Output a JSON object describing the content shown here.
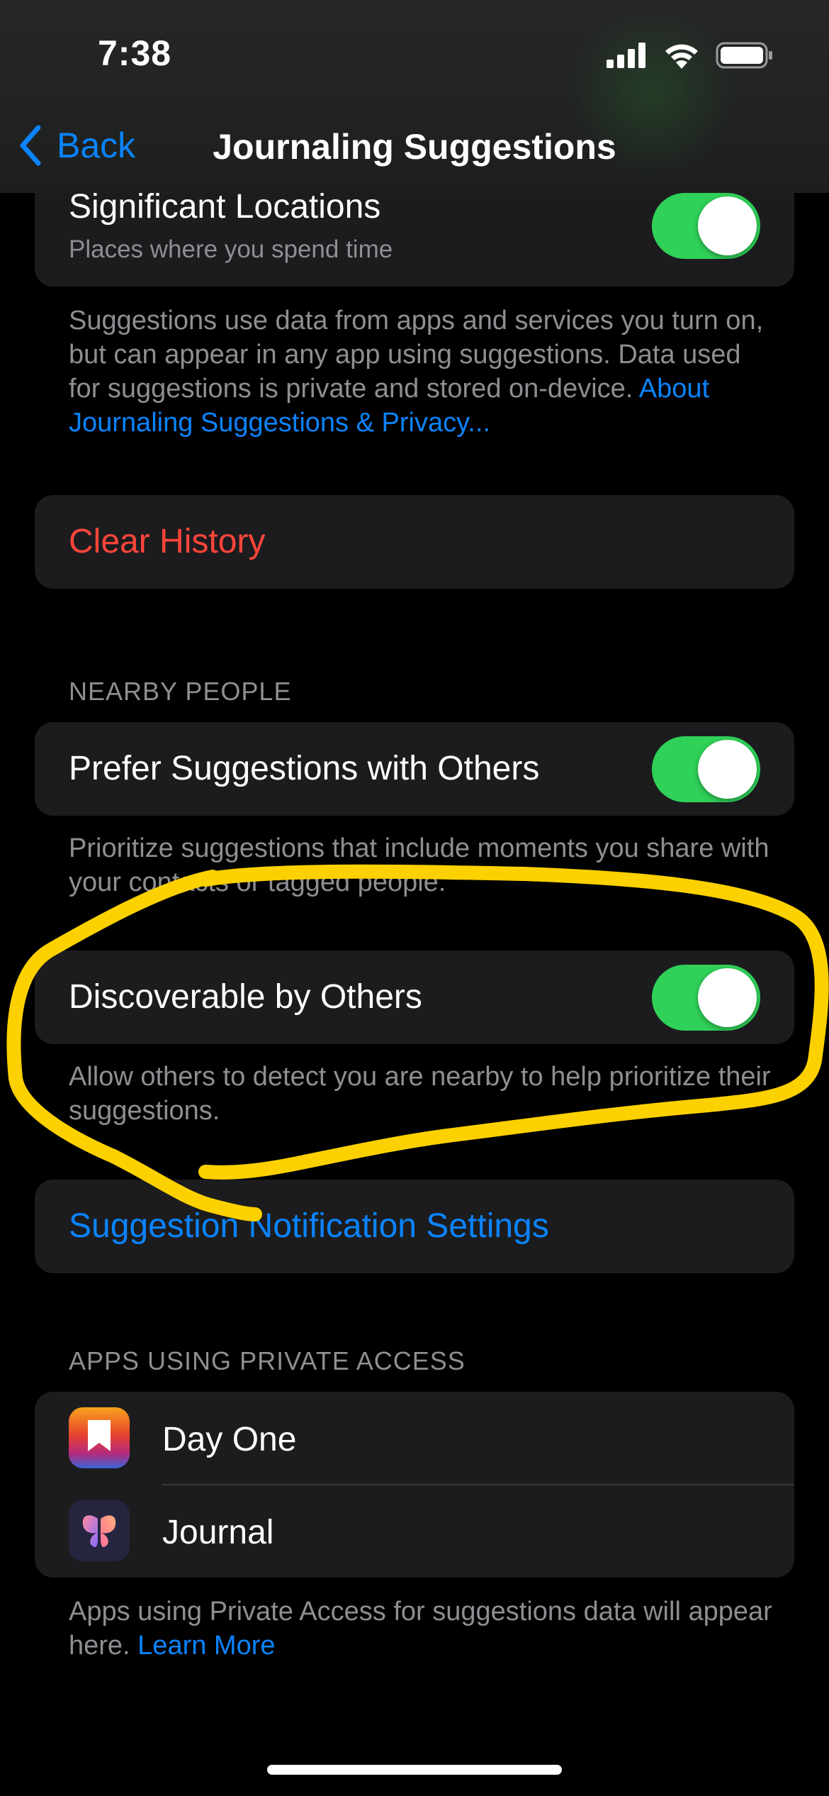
{
  "status_bar": {
    "time": "7:38"
  },
  "nav": {
    "back_label": "Back",
    "title": "Journaling Suggestions"
  },
  "locations": {
    "title": "Significant Locations",
    "subtitle": "Places where you spend time",
    "toggle_on": true
  },
  "privacy_note": {
    "text": "Suggestions use data from apps and services you turn on, but can appear in any app using suggestions. Data used for suggestions is private and stored on-device. ",
    "link": "About Journaling Suggestions & Privacy..."
  },
  "clear_history": {
    "label": "Clear History"
  },
  "nearby_people": {
    "header": "NEARBY PEOPLE",
    "prefer": {
      "label": "Prefer Suggestions with Others",
      "toggle_on": true
    },
    "prefer_note": "Prioritize suggestions that include moments you share with your contacts or tagged people.",
    "discoverable": {
      "label": "Discoverable by Others",
      "toggle_on": true
    },
    "discoverable_note": "Allow others to detect you are nearby to help prioritize their suggestions."
  },
  "notification_settings": {
    "label": "Suggestion Notification Settings"
  },
  "private_access": {
    "header": "APPS USING PRIVATE ACCESS",
    "apps": [
      {
        "name": "Day One",
        "icon": "day-one-bookmark-icon"
      },
      {
        "name": "Journal",
        "icon": "journal-butterfly-icon"
      }
    ],
    "note": "Apps using Private Access for suggestions data will appear here. ",
    "link": "Learn More"
  },
  "colors": {
    "accent": "#0a84ff",
    "destructive": "#ff453a",
    "toggle_on": "#30d158",
    "annotation": "#fdd100"
  }
}
